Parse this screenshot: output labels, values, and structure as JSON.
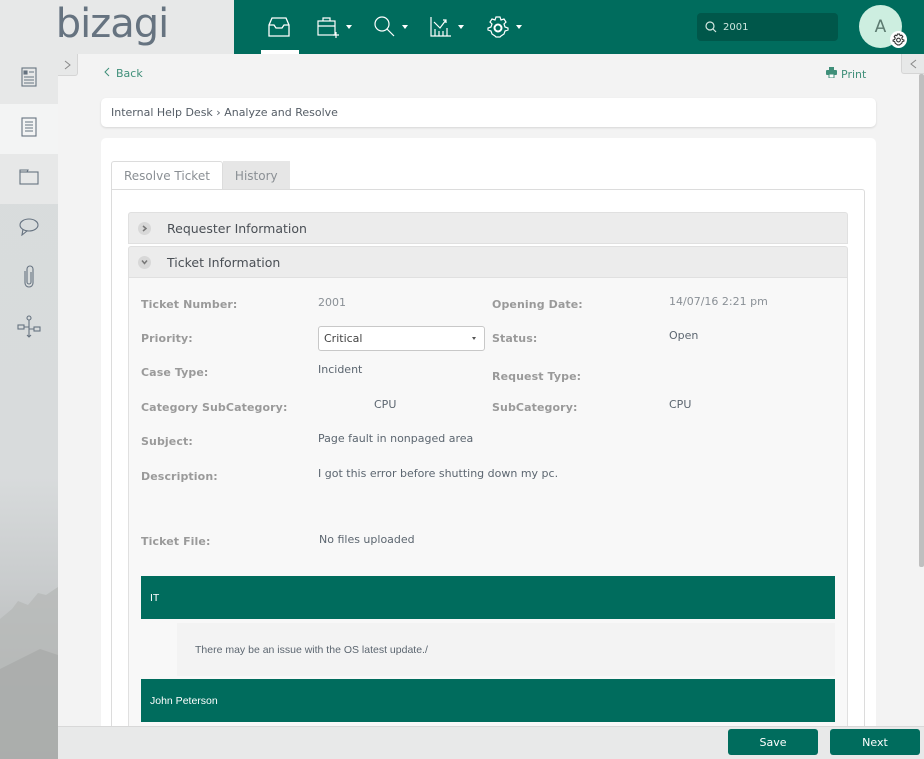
{
  "app": {
    "logo": "bizagi",
    "brand_color": "#006c5d"
  },
  "topnav": {
    "items": [
      {
        "icon": "inbox-icon",
        "active": true,
        "has_dropdown": false
      },
      {
        "icon": "new-case-icon",
        "active": false,
        "has_dropdown": true
      },
      {
        "icon": "search-icon",
        "active": false,
        "has_dropdown": true
      },
      {
        "icon": "analytics-icon",
        "active": false,
        "has_dropdown": true
      },
      {
        "icon": "settings-icon",
        "active": false,
        "has_dropdown": true
      }
    ],
    "search_value": "2001",
    "avatar_initial": "A"
  },
  "sidebar": {
    "items": [
      {
        "icon": "case-summary-icon"
      },
      {
        "icon": "form-list-icon"
      },
      {
        "icon": "folder-icon"
      },
      {
        "icon": "comments-icon"
      },
      {
        "icon": "attachment-icon"
      },
      {
        "icon": "process-map-icon"
      }
    ]
  },
  "page": {
    "back_label": "Back",
    "print_label": "Print",
    "breadcrumb": "Internal Help Desk › Analyze and Resolve"
  },
  "tabs": [
    {
      "label": "Resolve Ticket",
      "active": true
    },
    {
      "label": "History",
      "active": false
    }
  ],
  "accordions": {
    "requester": {
      "title": "Requester Information",
      "expanded": false
    },
    "ticket": {
      "title": "Ticket Information",
      "expanded": true
    }
  },
  "ticket": {
    "left": [
      {
        "label": "Ticket Number:",
        "value": "2001"
      },
      {
        "label": "Priority:",
        "value": "Critical"
      },
      {
        "label": "Case Type:",
        "value": "Incident"
      },
      {
        "label": "Category  SubCategory:",
        "value": "CPU"
      },
      {
        "label": "Subject:",
        "value": "Page fault in nonpaged area"
      },
      {
        "label": "Description:",
        "value": "I got this error before shutting down my pc."
      },
      {
        "label": "Ticket File:",
        "value": "No files uploaded"
      }
    ],
    "right": [
      {
        "label": "Opening Date:",
        "value": "14/07/16 2:21 pm"
      },
      {
        "label": "Status:",
        "value": "Open"
      },
      {
        "label": "Request Type:",
        "value": ""
      },
      {
        "label": "SubCategory:",
        "value": "CPU"
      }
    ]
  },
  "comments": [
    {
      "author": "IT",
      "text": "There may be an issue with the OS latest update./"
    },
    {
      "author": "John Peterson",
      "text": ""
    }
  ],
  "footer": {
    "save_label": "Save",
    "next_label": "Next"
  }
}
